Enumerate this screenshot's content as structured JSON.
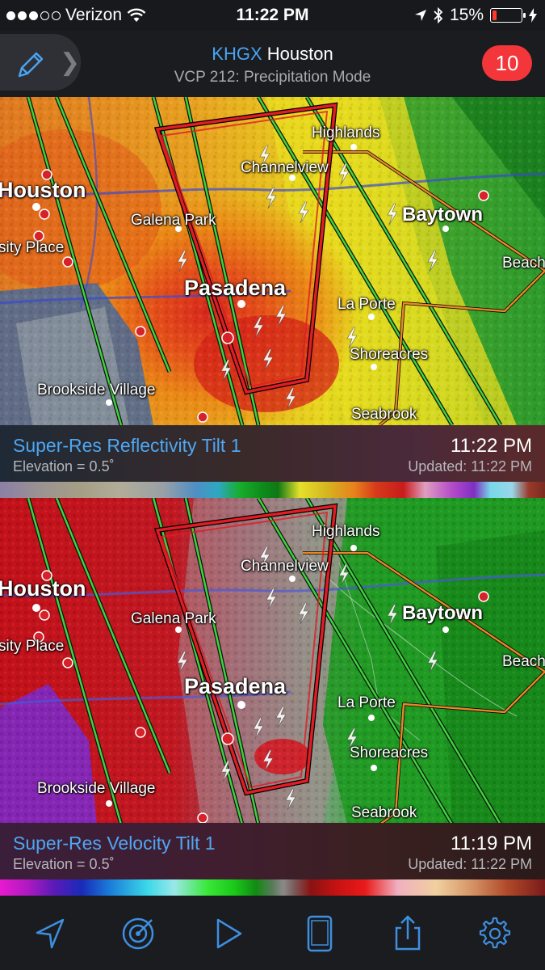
{
  "status_bar": {
    "carrier": "Verizon",
    "time": "11:22 PM",
    "battery": "15%",
    "signal_bars_filled": 3,
    "signal_bars_total": 5
  },
  "header": {
    "station_code": "KHGX",
    "station_name": "Houston",
    "subtitle": "VCP 212: Precipitation Mode",
    "alert_count": "10"
  },
  "map_labels": {
    "houston": "Houston",
    "highlands": "Highlands",
    "channelview": "Channelview",
    "baytown": "Baytown",
    "galena_park": "Galena Park",
    "sity_place": "sity Place",
    "beach": "Beach",
    "pasadena": "Pasadena",
    "la_porte": "La Porte",
    "shoreacres": "Shoreacres",
    "brookside_village": "Brookside Village",
    "seabrook": "Seabrook"
  },
  "panels": [
    {
      "product": "Super-Res Reflectivity Tilt 1",
      "elevation": "Elevation = 0.5˚",
      "time": "11:22 PM",
      "updated": "Updated: 11:22 PM"
    },
    {
      "product": "Super-Res Velocity Tilt 1",
      "elevation": "Elevation = 0.5˚",
      "time": "11:19 PM",
      "updated": "Updated: 11:22 PM"
    }
  ],
  "toolbar": {
    "icons": [
      "location-arrow-icon",
      "radar-icon",
      "play-icon",
      "tablet-icon",
      "share-icon",
      "settings-icon"
    ]
  },
  "colors": {
    "accent_blue": "#4ea7f2",
    "alert_red": "#f2363a",
    "warning_polygon": "#e01c24",
    "watch_polygon": "#e8862a",
    "county_line": "#3cd43c"
  }
}
